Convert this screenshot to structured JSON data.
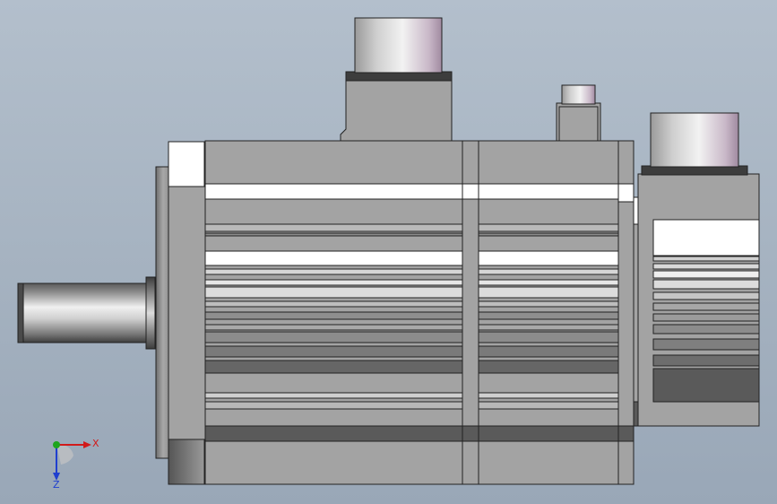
{
  "triad": {
    "x_label": "X",
    "z_label": "Z"
  },
  "colors": {
    "background_top": "#b3bfcc",
    "background_bottom": "#99a7b7",
    "body_gray": "#a3a3a3",
    "dark_band": "#5a5a5a",
    "white_band": "#ffffff",
    "x_axis": "#d11a1a",
    "y_axis": "#1ea51e",
    "z_axis": "#1f3fcf"
  }
}
